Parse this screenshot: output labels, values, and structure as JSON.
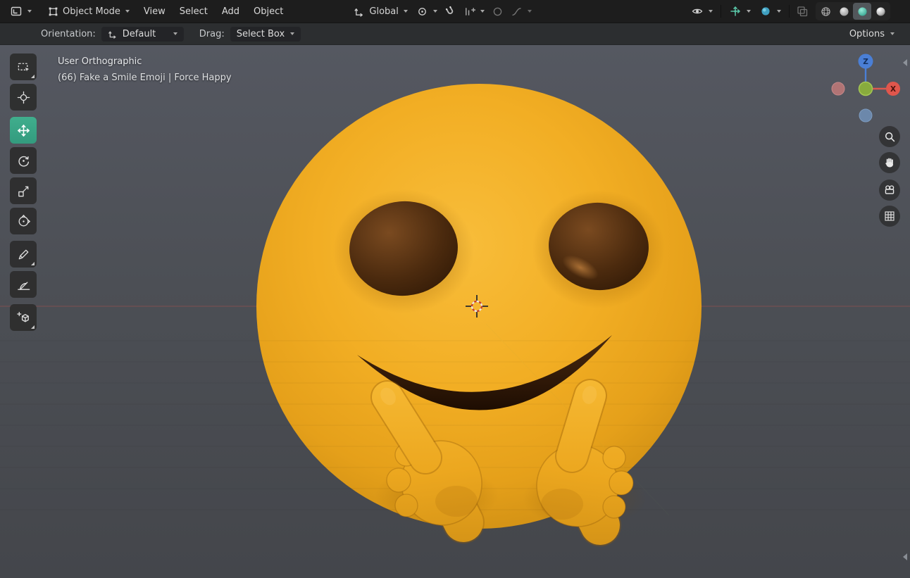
{
  "header": {
    "mode_label": "Object Mode",
    "menus": [
      {
        "label": "View"
      },
      {
        "label": "Select"
      },
      {
        "label": "Add"
      },
      {
        "label": "Object"
      }
    ],
    "transform_orientation": "Global"
  },
  "tool_settings": {
    "orientation_label": "Orientation:",
    "orientation_value": "Default",
    "drag_label": "Drag:",
    "drag_value": "Select Box",
    "options_label": "Options"
  },
  "viewport": {
    "view_label": "User Orthographic",
    "object_label": "(66) Fake a Smile Emoji | Force Happy"
  },
  "nav_gizmo": {
    "z_label": "Z",
    "x_label": "X"
  },
  "icons": [
    "editor-type-icon",
    "object-mode-icon",
    "chevron-down-icon",
    "orientation-axes-icon",
    "pivot-point-icon",
    "magnet-icon",
    "snap-target-icon",
    "proportional-circle-icon",
    "falloff-curve-icon",
    "eye-icon",
    "gizmos-icon",
    "overlays-sphere-icon",
    "xray-icon",
    "wireframe-sphere-icon",
    "solid-sphere-icon",
    "material-sphere-icon",
    "rendered-sphere-icon",
    "box-select-icon",
    "cursor-icon",
    "move-icon",
    "rotate-icon",
    "scale-icon",
    "transform-icon",
    "annotate-icon",
    "measure-icon",
    "add-cube-icon",
    "zoom-icon",
    "pan-hand-icon",
    "camera-icon",
    "ortho-grid-icon"
  ],
  "colors": {
    "header_bg": "#1d1d1d",
    "tool_settings_bg": "#2c2e30",
    "viewport_top": "#555861",
    "viewport_bottom": "#44464b",
    "active_tool_teal": "#3aa183",
    "face_yellow": "#f0ac23",
    "eye_brown": "#45260c",
    "axis_x_red": "#e0564c",
    "axis_y_green": "#88ab3d",
    "axis_z_blue": "#4a7fd6"
  }
}
